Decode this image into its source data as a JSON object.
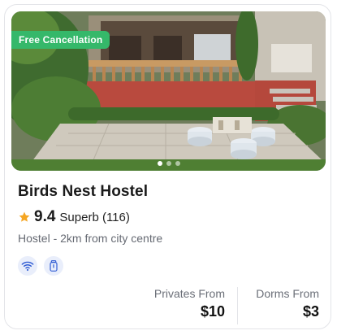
{
  "listing": {
    "badge": "Free Cancellation",
    "name": "Birds Nest Hostel",
    "rating_score": "9.4",
    "rating_label": "Superb (116)",
    "subtitle": "Hostel - 2km from city centre",
    "facilities": [
      {
        "icon": "wifi-icon"
      },
      {
        "icon": "locker-icon"
      }
    ],
    "prices": {
      "privates_label": "Privates From",
      "privates_value": "$10",
      "dorms_label": "Dorms From",
      "dorms_value": "$3"
    },
    "carousel": {
      "count": 3,
      "active_index": 0
    },
    "colors": {
      "badge": "#35b86a",
      "star": "#f5a623",
      "icon_blue": "#2f5bd3",
      "facility_bg": "#e9eefb"
    }
  }
}
